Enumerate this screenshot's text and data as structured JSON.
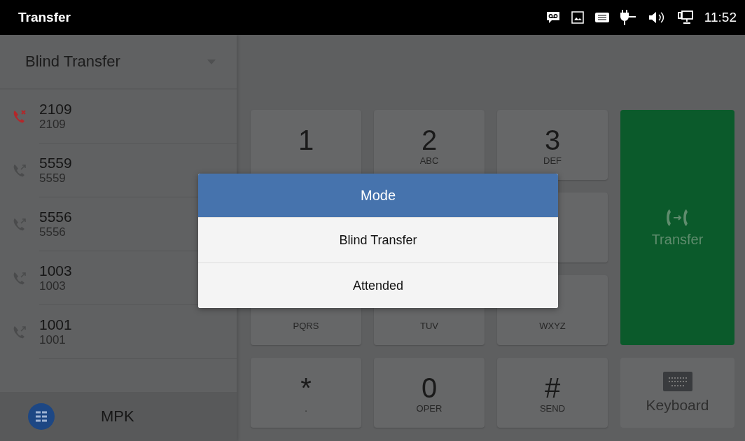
{
  "status_bar": {
    "title": "Transfer",
    "time": "11:52"
  },
  "mode_select": {
    "value": "Blind Transfer"
  },
  "calls": [
    {
      "name": "2109",
      "number": "2109",
      "kind": "missed"
    },
    {
      "name": "5559",
      "number": "5559",
      "kind": "outgoing"
    },
    {
      "name": "5556",
      "number": "5556",
      "kind": "outgoing"
    },
    {
      "name": "1003",
      "number": "1003",
      "kind": "outgoing"
    },
    {
      "name": "1001",
      "number": "1001",
      "kind": "outgoing"
    }
  ],
  "bottom_bar": {
    "label": "MPK"
  },
  "keypad": [
    {
      "digit": "1"
    },
    {
      "digit": "2",
      "letters": "ABC"
    },
    {
      "digit": "3",
      "letters": "DEF"
    },
    {
      "letters": "PQRS"
    },
    {
      "letters": "TUV"
    },
    {
      "letters": "WXYZ"
    },
    {
      "digit": "*",
      "letters": "."
    },
    {
      "digit": "0",
      "letters": "OPER"
    },
    {
      "digit": "#",
      "letters": "SEND"
    }
  ],
  "transfer_button": {
    "label": "Transfer"
  },
  "keyboard_button": {
    "label": "Keyboard"
  },
  "dialog": {
    "title": "Mode",
    "options": [
      "Blind Transfer",
      "Attended"
    ]
  }
}
